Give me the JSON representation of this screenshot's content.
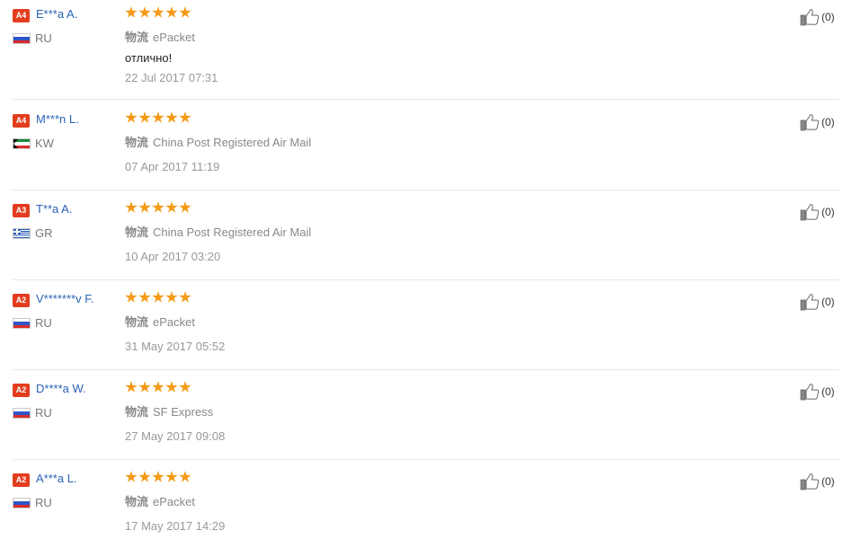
{
  "reviews": [
    {
      "badge": "A4",
      "name": "E***a A.",
      "country": "RU",
      "flag_colors": [
        "#ffffff",
        "#2e54c8",
        "#d92b2b"
      ],
      "rating": 5,
      "shipping_label": "物流",
      "shipping": "ePacket",
      "comment": "отлично!",
      "date": "22 Jul 2017 07:31",
      "likes": "(0)"
    },
    {
      "badge": "A4",
      "name": "M***n L.",
      "country": "KW",
      "flag_colors": [
        "#1a8a3a",
        "#ffffff",
        "#d92b2b"
      ],
      "rating": 5,
      "shipping_label": "物流",
      "shipping": "China Post Registered Air Mail",
      "comment": "",
      "date": "07 Apr 2017 11:19",
      "likes": "(0)"
    },
    {
      "badge": "A3",
      "name": "T**a A.",
      "country": "GR",
      "flag_colors": [
        "#2e5fb8",
        "#ffffff"
      ],
      "rating": 5,
      "shipping_label": "物流",
      "shipping": "China Post Registered Air Mail",
      "comment": "",
      "date": "10 Apr 2017 03:20",
      "likes": "(0)"
    },
    {
      "badge": "A2",
      "name": "V*******v F.",
      "country": "RU",
      "flag_colors": [
        "#ffffff",
        "#2e54c8",
        "#d92b2b"
      ],
      "rating": 5,
      "shipping_label": "物流",
      "shipping": "ePacket",
      "comment": "",
      "date": "31 May 2017 05:52",
      "likes": "(0)"
    },
    {
      "badge": "A2",
      "name": "D****a W.",
      "country": "RU",
      "flag_colors": [
        "#ffffff",
        "#2e54c8",
        "#d92b2b"
      ],
      "rating": 5,
      "shipping_label": "物流",
      "shipping": "SF Express",
      "comment": "",
      "date": "27 May 2017 09:08",
      "likes": "(0)"
    },
    {
      "badge": "A2",
      "name": "A***a L.",
      "country": "RU",
      "flag_colors": [
        "#ffffff",
        "#2e54c8",
        "#d92b2b"
      ],
      "rating": 5,
      "shipping_label": "物流",
      "shipping": "ePacket",
      "comment": "",
      "date": "17 May 2017 14:29",
      "likes": "(0)"
    }
  ],
  "colors": {
    "badge": "#e23d1e",
    "name_link": "#2a61b5",
    "star": "#f59a17"
  }
}
